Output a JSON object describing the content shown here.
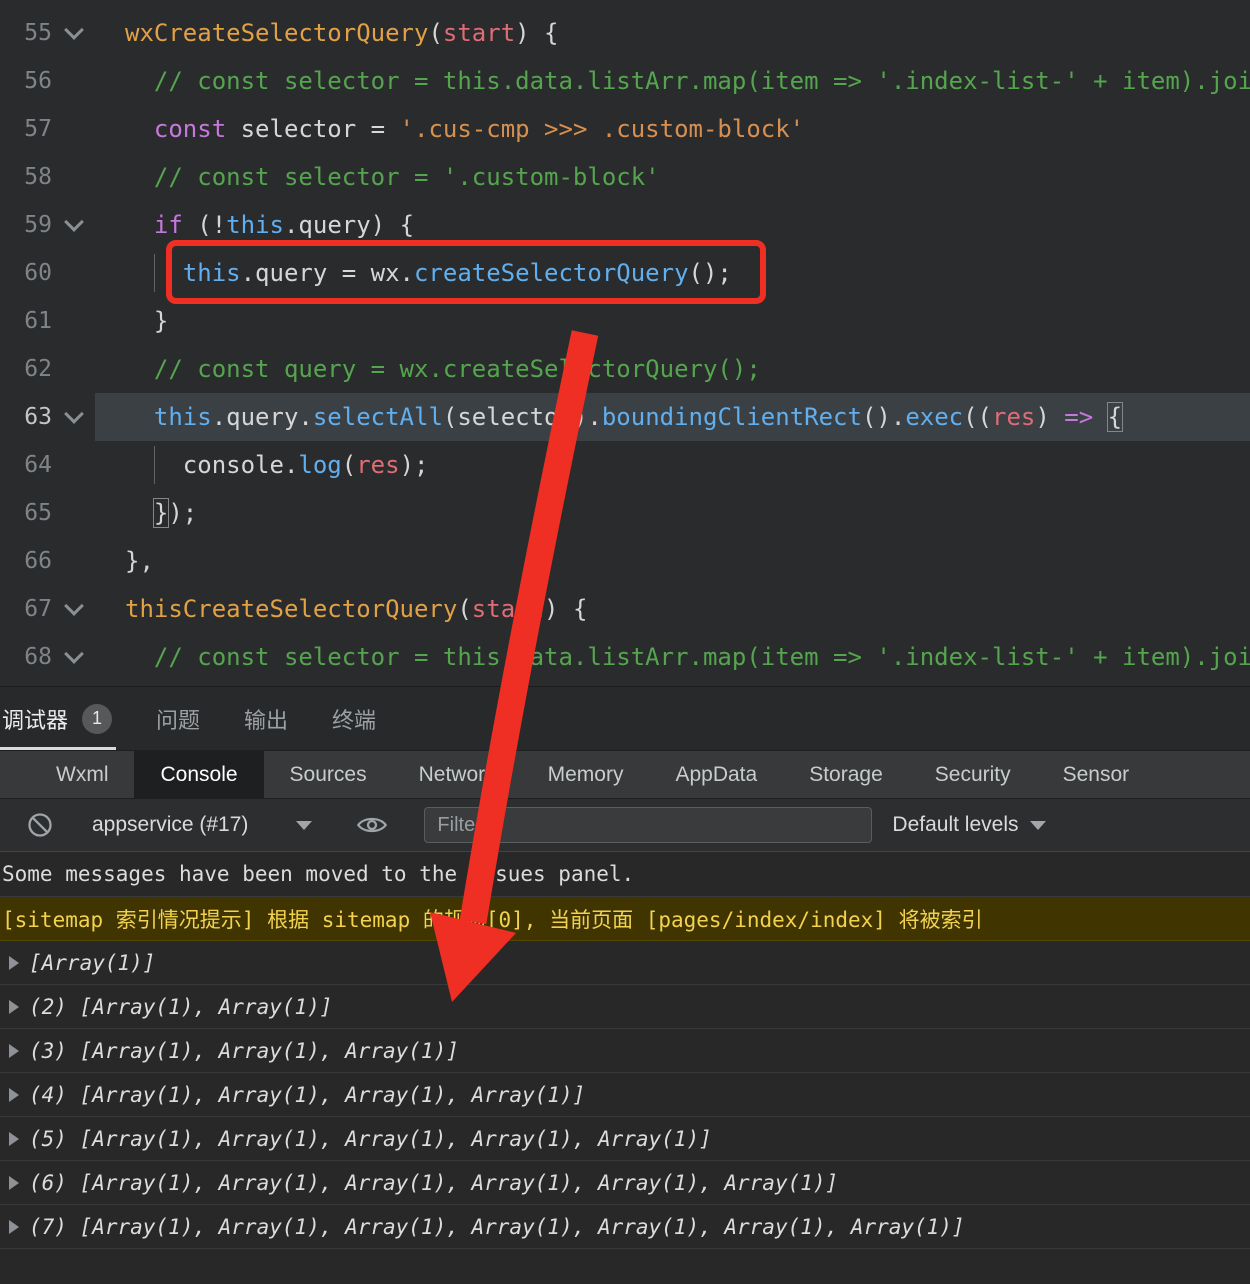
{
  "colors": {
    "annotation_red": "#ef2f24",
    "warning_bg": "#403500",
    "warning_text": "#f2d24f",
    "accent_blue": "#61afef"
  },
  "editor": {
    "lines": [
      {
        "num": "55",
        "fold": true,
        "indent": 0,
        "tokens": [
          [
            "fn",
            "wxCreateSelectorQuery"
          ],
          [
            "d",
            "("
          ],
          [
            "param",
            "start"
          ],
          [
            "d",
            ") {"
          ]
        ]
      },
      {
        "num": "56",
        "indent": 2,
        "tokens": [
          [
            "cm",
            "// const selector = this.data.listArr.map(item => '.index-list-' + item).join(',')"
          ]
        ]
      },
      {
        "num": "57",
        "indent": 2,
        "tokens": [
          [
            "kw",
            "const"
          ],
          [
            "d",
            " selector = "
          ],
          [
            "str",
            "'.cus-cmp >>> .custom-block'"
          ]
        ]
      },
      {
        "num": "58",
        "indent": 2,
        "tokens": [
          [
            "cm",
            "// const selector = '.custom-block'"
          ]
        ]
      },
      {
        "num": "59",
        "fold": true,
        "indent": 2,
        "tokens": [
          [
            "kw",
            "if"
          ],
          [
            "d",
            " (!"
          ],
          [
            "this",
            "this"
          ],
          [
            "d",
            ".query) {"
          ]
        ]
      },
      {
        "num": "60",
        "indent": 4,
        "guide": true,
        "tokens": [
          [
            "this",
            "this"
          ],
          [
            "d",
            ".query = wx."
          ],
          [
            "fn2",
            "createSelectorQuery"
          ],
          [
            "d",
            "();"
          ]
        ]
      },
      {
        "num": "61",
        "indent": 2,
        "tokens": [
          [
            "d",
            "}"
          ]
        ]
      },
      {
        "num": "62",
        "indent": 2,
        "tokens": [
          [
            "cm",
            "// const query = wx.createSelectorQuery();"
          ]
        ]
      },
      {
        "num": "63",
        "fold": true,
        "indent": 2,
        "highlight": true,
        "tokens": [
          [
            "this",
            "this"
          ],
          [
            "d",
            ".query."
          ],
          [
            "fn2",
            "selectAll"
          ],
          [
            "d",
            "(selector)."
          ],
          [
            "fn2",
            "boundingClientRect"
          ],
          [
            "d",
            "()."
          ],
          [
            "fn2",
            "exec"
          ],
          [
            "d",
            "(("
          ],
          [
            "param",
            "res"
          ],
          [
            "d",
            ") "
          ],
          [
            "kw",
            "=>"
          ],
          [
            "d",
            " "
          ],
          [
            "bx",
            "{"
          ]
        ]
      },
      {
        "num": "64",
        "indent": 4,
        "guide": true,
        "tokens": [
          [
            "d",
            "console."
          ],
          [
            "fn2",
            "log"
          ],
          [
            "d",
            "("
          ],
          [
            "param",
            "res"
          ],
          [
            "d",
            ");"
          ]
        ]
      },
      {
        "num": "65",
        "indent": 2,
        "tokens": [
          [
            "bx",
            "}"
          ],
          [
            "d",
            ");"
          ]
        ]
      },
      {
        "num": "66",
        "indent": 0,
        "tokens": [
          [
            "d",
            "},"
          ]
        ]
      },
      {
        "num": "67",
        "fold": true,
        "indent": 0,
        "tokens": [
          [
            "fn",
            "thisCreateSelectorQuery"
          ],
          [
            "d",
            "("
          ],
          [
            "param",
            "start"
          ],
          [
            "d",
            ") {"
          ]
        ]
      },
      {
        "num": "68",
        "fold": true,
        "indent": 2,
        "tokens": [
          [
            "cm",
            "// const selector = this.data.listArr.map(item => '.index-list-' + item).join(',')"
          ]
        ]
      }
    ]
  },
  "debugger_bar": {
    "tabs": [
      {
        "label": "调试器",
        "badge": "1",
        "active": true
      },
      {
        "label": "问题"
      },
      {
        "label": "输出"
      },
      {
        "label": "终端"
      }
    ]
  },
  "devtools_bar": {
    "tabs": [
      "Wxml",
      "Console",
      "Sources",
      "Network",
      "Memory",
      "AppData",
      "Storage",
      "Security",
      "Sensor"
    ],
    "active": "Console"
  },
  "toolbar": {
    "context_label": "appservice (#17)",
    "filter_placeholder": "Filter",
    "levels_label": "Default levels"
  },
  "console": {
    "messages": [
      {
        "type": "info",
        "text": "Some messages have been moved to the Issues panel."
      },
      {
        "type": "warning",
        "text": "[sitemap 索引情况提示] 根据 sitemap 的规则[0], 当前页面 [pages/index/index] 将被索引"
      },
      {
        "type": "log",
        "expandable": true,
        "text": "[Array(1)]"
      },
      {
        "type": "log",
        "expandable": true,
        "text": "(2) [Array(1), Array(1)]"
      },
      {
        "type": "log",
        "expandable": true,
        "text": "(3) [Array(1), Array(1), Array(1)]"
      },
      {
        "type": "log",
        "expandable": true,
        "text": "(4) [Array(1), Array(1), Array(1), Array(1)]"
      },
      {
        "type": "log",
        "expandable": true,
        "text": "(5) [Array(1), Array(1), Array(1), Array(1), Array(1)]"
      },
      {
        "type": "log",
        "expandable": true,
        "text": "(6) [Array(1), Array(1), Array(1), Array(1), Array(1), Array(1)]"
      },
      {
        "type": "log",
        "expandable": true,
        "text": "(7) [Array(1), Array(1), Array(1), Array(1), Array(1), Array(1), Array(1)]"
      }
    ]
  }
}
